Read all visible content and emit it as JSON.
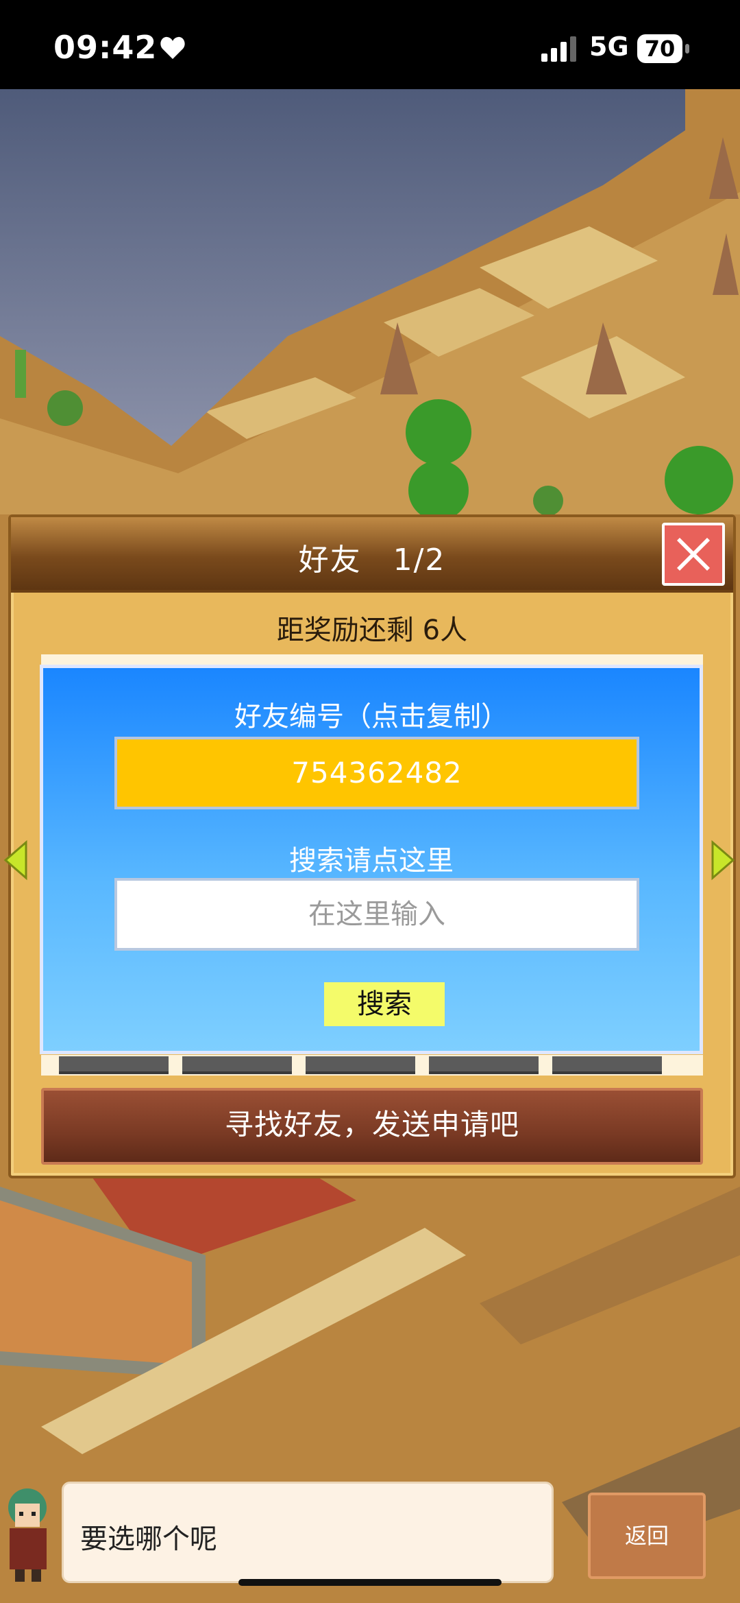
{
  "status_bar": {
    "time": "09:42",
    "network": "5G",
    "battery": "70",
    "icons": [
      "heart-icon",
      "signal-icon",
      "battery-icon"
    ]
  },
  "friend_panel": {
    "title": "好友　1/2",
    "reward_text": "距奖励还剩 6人",
    "friend_id_label": "好友编号（点击复制）",
    "friend_id": "754362482",
    "search_hint": "搜索请点这里",
    "search_placeholder": "在这里输入",
    "search_button": "搜索",
    "find_friends_button": "寻找好友，发送申请吧",
    "page_indicator_count": 5
  },
  "dialog": {
    "text": "要选哪个呢",
    "back_button": "返回"
  },
  "colors": {
    "panel_bg": "#e8b85c",
    "card_blue": "#1a86ff",
    "id_yellow": "#ffc500",
    "close_red": "#e8615a",
    "button_brown": "#7a3a24",
    "search_button_yellow": "#f4fb6a"
  }
}
